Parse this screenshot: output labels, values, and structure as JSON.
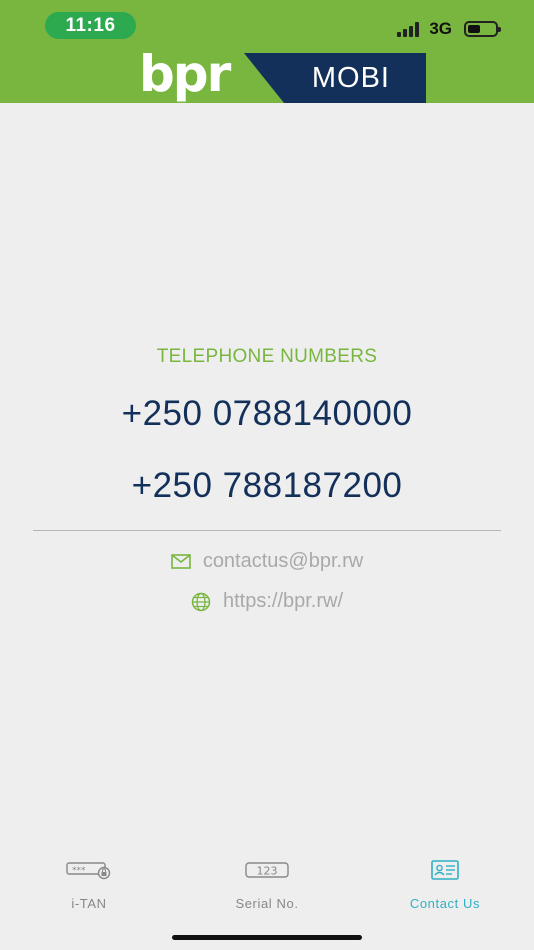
{
  "status_bar": {
    "time": "11:16",
    "network": "3G",
    "battery_level": 0.45
  },
  "logo": {
    "brand": "bpr",
    "product": "MOBI"
  },
  "contact": {
    "section_title": "TELEPHONE NUMBERS",
    "phones": [
      "+250 0788140000",
      "+250 788187200"
    ],
    "email": "contactus@bpr.rw",
    "website": "https://bpr.rw/"
  },
  "tabs": [
    {
      "label": "i-TAN",
      "icon": "password-lock-icon",
      "active": false
    },
    {
      "label": "Serial No.",
      "icon": "serial-number-icon",
      "active": false
    },
    {
      "label": "Contact Us",
      "icon": "contact-card-icon",
      "active": true
    }
  ],
  "colors": {
    "brand_green": "#79b640",
    "brand_navy": "#13305a",
    "active_tab": "#2fb0c4",
    "inactive_tab": "#888888"
  }
}
